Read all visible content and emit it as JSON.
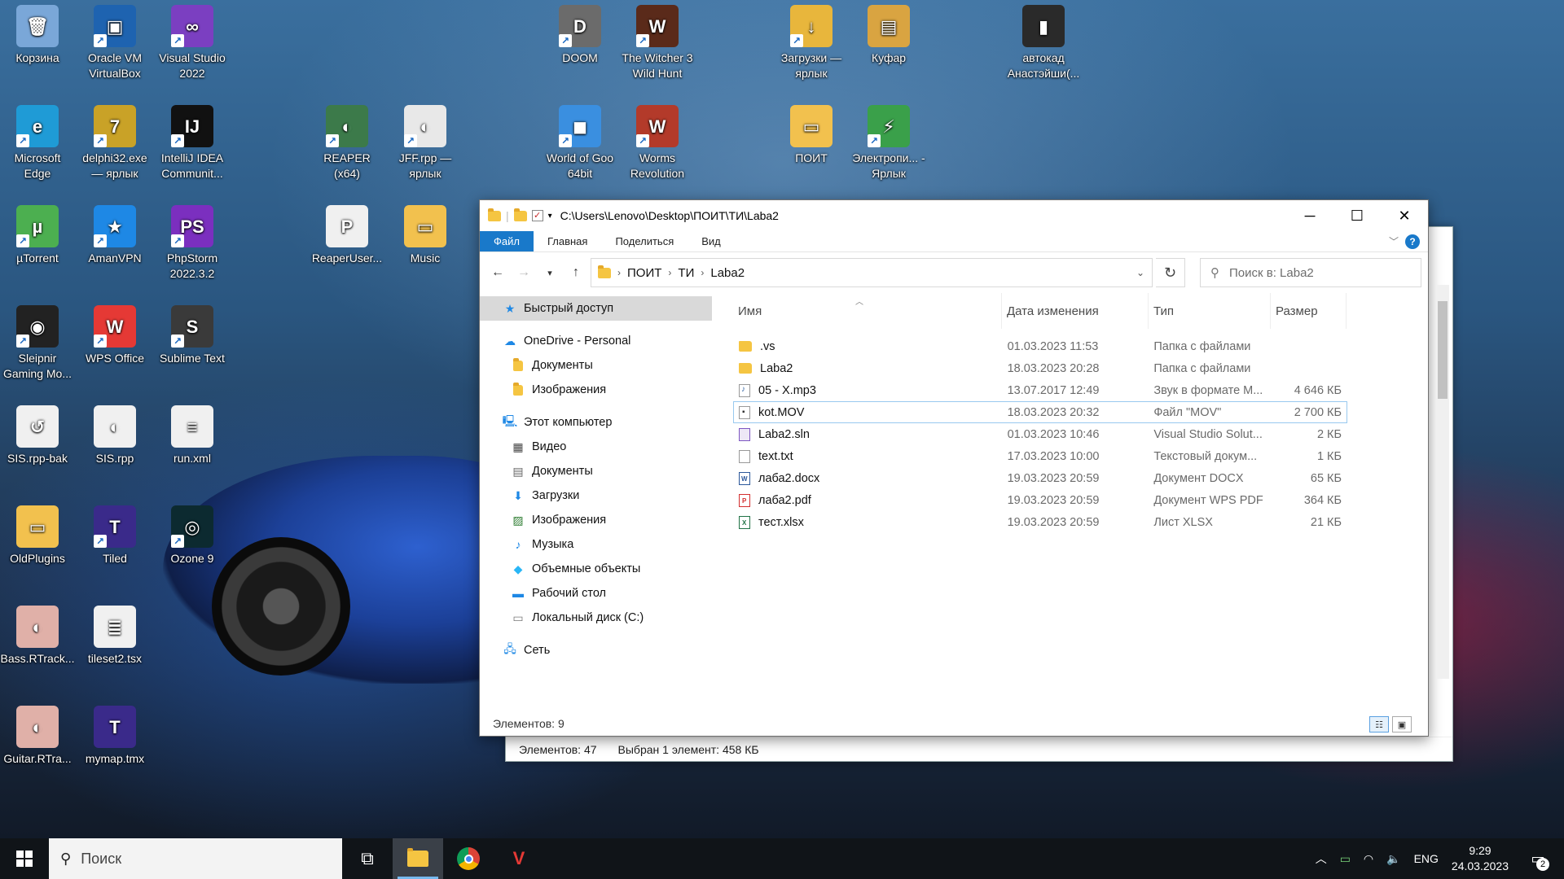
{
  "desktop": {
    "icons": [
      {
        "id": "recycle",
        "label": "Корзина",
        "color": "#7aa7d8",
        "glyph": "🗑",
        "shortcut": false
      },
      {
        "id": "virtualbox",
        "label": "Oracle VM VirtualBox",
        "color": "#1e63b0",
        "glyph": "▣",
        "shortcut": true
      },
      {
        "id": "vs2022",
        "label": "Visual Studio 2022",
        "color": "#7b3fc1",
        "glyph": "∞",
        "shortcut": true
      },
      {
        "id": "edge",
        "label": "Microsoft Edge",
        "color": "#1f9bd6",
        "glyph": "e",
        "shortcut": true
      },
      {
        "id": "delphi",
        "label": "delphi32.exe — ярлык",
        "color": "#c9a227",
        "glyph": "7",
        "shortcut": true
      },
      {
        "id": "intellij",
        "label": "IntelliJ IDEA Communit...",
        "color": "#111111",
        "glyph": "IJ",
        "shortcut": true
      },
      {
        "id": "reaper",
        "label": "REAPER (x64)",
        "color": "#3c7a4a",
        "glyph": "◐",
        "shortcut": true
      },
      {
        "id": "jff",
        "label": "JFF.rpp — ярлык",
        "color": "#e8e8e8",
        "glyph": "◐",
        "shortcut": true
      },
      {
        "id": "doom",
        "label": "DOOM",
        "color": "#6b6b6b",
        "glyph": "D",
        "shortcut": true
      },
      {
        "id": "witcher",
        "label": "The Witcher 3 Wild Hunt",
        "color": "#5a2a1a",
        "glyph": "W",
        "shortcut": true
      },
      {
        "id": "downloads",
        "label": "Загрузки — ярлык",
        "color": "#e8b63c",
        "glyph": "↓",
        "shortcut": true
      },
      {
        "id": "kufar",
        "label": "Куфар",
        "color": "#d9a441",
        "glyph": "▤",
        "shortcut": false
      },
      {
        "id": "autocad",
        "label": "автокад Анастэйши(...",
        "color": "#2a2a2a",
        "glyph": "▮",
        "shortcut": false
      },
      {
        "id": "wot",
        "label": "World of Goo 64bit",
        "color": "#3a8fe0",
        "glyph": "◼",
        "shortcut": true
      },
      {
        "id": "worms",
        "label": "Worms Revolution",
        "color": "#b33a2a",
        "glyph": "W",
        "shortcut": true
      },
      {
        "id": "poit",
        "label": "ПОИТ",
        "color": "#f2c14e",
        "glyph": "▭",
        "shortcut": false
      },
      {
        "id": "electro",
        "label": "Электропи... - Ярлык",
        "color": "#3aa04a",
        "glyph": "⚡",
        "shortcut": true
      },
      {
        "id": "utorrent",
        "label": "µTorrent",
        "color": "#4caf50",
        "glyph": "µ",
        "shortcut": true
      },
      {
        "id": "amanvpn",
        "label": "AmanVPN",
        "color": "#1e88e5",
        "glyph": "★",
        "shortcut": true
      },
      {
        "id": "phpstorm",
        "label": "PhpStorm 2022.3.2",
        "color": "#7b2fbf",
        "glyph": "PS",
        "shortcut": true
      },
      {
        "id": "reaperuser",
        "label": "ReaperUser...",
        "color": "#f0f0f0",
        "glyph": "P",
        "shortcut": false
      },
      {
        "id": "music",
        "label": "Music",
        "color": "#f2c14e",
        "glyph": "▭",
        "shortcut": false
      },
      {
        "id": "sleipnir",
        "label": "Sleipnir Gaming Mo...",
        "color": "#222222",
        "glyph": "◉",
        "shortcut": true
      },
      {
        "id": "wps",
        "label": "WPS Office",
        "color": "#e53935",
        "glyph": "W",
        "shortcut": true
      },
      {
        "id": "sublime",
        "label": "Sublime Text",
        "color": "#3a3a3a",
        "glyph": "S",
        "shortcut": true
      },
      {
        "id": "sisbak",
        "label": "SIS.rpp-bak",
        "color": "#f0f0f0",
        "glyph": "↺",
        "shortcut": false
      },
      {
        "id": "sisrpp",
        "label": "SIS.rpp",
        "color": "#f0f0f0",
        "glyph": "◐",
        "shortcut": false
      },
      {
        "id": "runxml",
        "label": "run.xml",
        "color": "#f0f0f0",
        "glyph": "≡",
        "shortcut": false
      },
      {
        "id": "oldplugins",
        "label": "OldPlugins",
        "color": "#f2c14e",
        "glyph": "▭",
        "shortcut": false
      },
      {
        "id": "tiled",
        "label": "Tiled",
        "color": "#3a2a8a",
        "glyph": "T",
        "shortcut": true
      },
      {
        "id": "ozone",
        "label": "Ozone 9",
        "color": "#0c2a30",
        "glyph": "◎",
        "shortcut": true
      },
      {
        "id": "bass",
        "label": "Bass.RTrack...",
        "color": "#e0b0a8",
        "glyph": "◐",
        "shortcut": false
      },
      {
        "id": "tileset",
        "label": "tileset2.tsx",
        "color": "#f0f0f0",
        "glyph": "≣",
        "shortcut": false
      },
      {
        "id": "guitar",
        "label": "Guitar.RTra...",
        "color": "#e0b0a8",
        "glyph": "◐",
        "shortcut": false
      },
      {
        "id": "mymap",
        "label": "mymap.tmx",
        "color": "#3a2a8a",
        "glyph": "T",
        "shortcut": false
      }
    ]
  },
  "back_window": {
    "status_count": "Элементов: 47",
    "status_selected": "Выбран 1 элемент: 458 КБ"
  },
  "explorer": {
    "title": "C:\\Users\\Lenovo\\Desktop\\ПОИТ\\ТИ\\Laba2",
    "ribbon": {
      "file": "Файл",
      "home": "Главная",
      "share": "Поделиться",
      "view": "Вид"
    },
    "breadcrumb": [
      "ПОИТ",
      "ТИ",
      "Laba2"
    ],
    "search_placeholder": "Поиск в: Laba2",
    "nav": {
      "quick_access": "Быстрый доступ",
      "onedrive": "OneDrive - Personal",
      "od_docs": "Документы",
      "od_images": "Изображения",
      "this_pc": "Этот компьютер",
      "video": "Видео",
      "docs": "Документы",
      "downloads": "Загрузки",
      "images": "Изображения",
      "music": "Музыка",
      "objects3d": "Объемные объекты",
      "desktop": "Рабочий стол",
      "local_disk": "Локальный диск (C:)",
      "network": "Сеть"
    },
    "columns": {
      "name": "Имя",
      "date": "Дата изменения",
      "type": "Тип",
      "size": "Размер"
    },
    "files": [
      {
        "name": ".vs",
        "date": "01.03.2023 11:53",
        "type": "Папка с файлами",
        "size": "",
        "kind": "fold"
      },
      {
        "name": "Laba2",
        "date": "18.03.2023 20:28",
        "type": "Папка с файлами",
        "size": "",
        "kind": "fold"
      },
      {
        "name": "05 - X.mp3",
        "date": "13.07.2017 12:49",
        "type": "Звук в формате M...",
        "size": "4 646 КБ",
        "kind": "mp3"
      },
      {
        "name": "kot.MOV",
        "date": "18.03.2023 20:32",
        "type": "Файл \"MOV\"",
        "size": "2 700 КБ",
        "kind": "mov",
        "focused": true
      },
      {
        "name": "Laba2.sln",
        "date": "01.03.2023 10:46",
        "type": "Visual Studio Solut...",
        "size": "2 КБ",
        "kind": "sln"
      },
      {
        "name": "text.txt",
        "date": "17.03.2023 10:00",
        "type": "Текстовый докум...",
        "size": "1 КБ",
        "kind": "txt"
      },
      {
        "name": "лаба2.docx",
        "date": "19.03.2023 20:59",
        "type": "Документ DOCX",
        "size": "65 КБ",
        "kind": "docx"
      },
      {
        "name": "лаба2.pdf",
        "date": "19.03.2023 20:59",
        "type": "Документ WPS PDF",
        "size": "364 КБ",
        "kind": "pdf"
      },
      {
        "name": "тест.xlsx",
        "date": "19.03.2023 20:59",
        "type": "Лист XLSX",
        "size": "21 КБ",
        "kind": "xlsx"
      }
    ],
    "status": "Элементов: 9"
  },
  "taskbar": {
    "search_placeholder": "Поиск",
    "lang": "ENG",
    "time": "9:29",
    "date": "24.03.2023",
    "notifications": "2"
  }
}
